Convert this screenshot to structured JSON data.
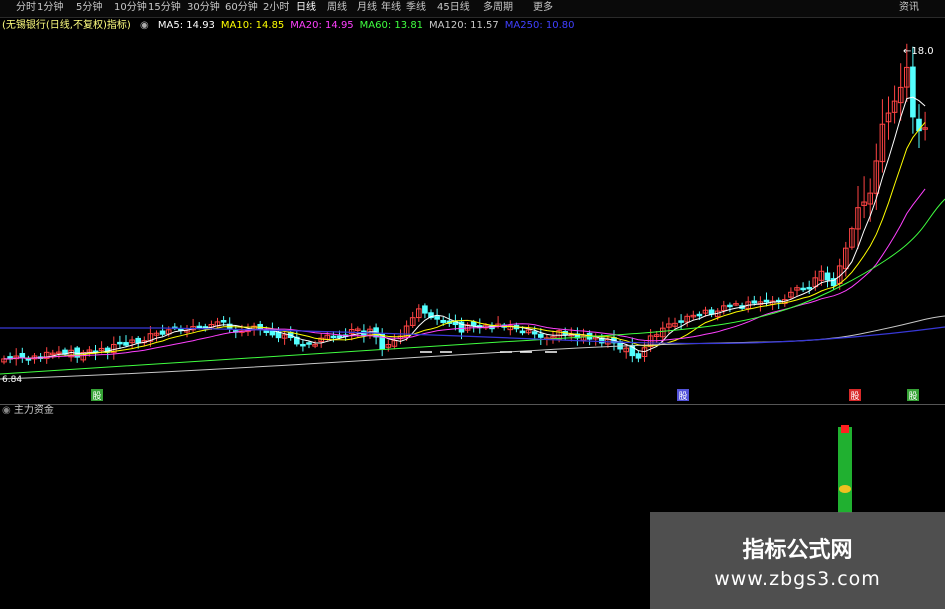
{
  "tabs": [
    "分时",
    "1分钟",
    "5分钟",
    "10分钟",
    "15分钟",
    "30分钟",
    "60分钟",
    "2小时",
    "日线",
    "周线",
    "月线",
    "年线",
    "季线",
    "45日线",
    "多周期",
    "更多"
  ],
  "active_tab": "日线",
  "stock_tab": "资讯",
  "ma_legend": {
    "title": "(无锡银行(日线,不复权)指标)",
    "items": [
      {
        "label": "MA5: 14.93",
        "color": "#ffffff"
      },
      {
        "label": "MA10: 14.85",
        "color": "#ffff00"
      },
      {
        "label": "MA20: 14.95",
        "color": "#ff40ff"
      },
      {
        "label": "MA60: 13.81",
        "color": "#40ff40"
      },
      {
        "label": "MA120: 11.57",
        "color": "#c8c8c8"
      },
      {
        "label": "MA250: 10.80",
        "color": "#4040ff"
      }
    ]
  },
  "price_high_label": "18.0",
  "price_low_label": "6.84",
  "signals": [
    {
      "label": "股",
      "color": "#40c040"
    },
    {
      "label": "股",
      "color": "#6060ff"
    },
    {
      "label": "股",
      "color": "#ff3030"
    },
    {
      "label": "股",
      "color": "#40c040"
    }
  ],
  "indicator_title": "主力资金",
  "watermark": {
    "title": "指标公式网",
    "url": "www.zbgs3.com"
  },
  "colors": {
    "up": "#ff4444",
    "down": "#54ffff",
    "background": "#000000",
    "ma250": "#3838d8"
  }
}
